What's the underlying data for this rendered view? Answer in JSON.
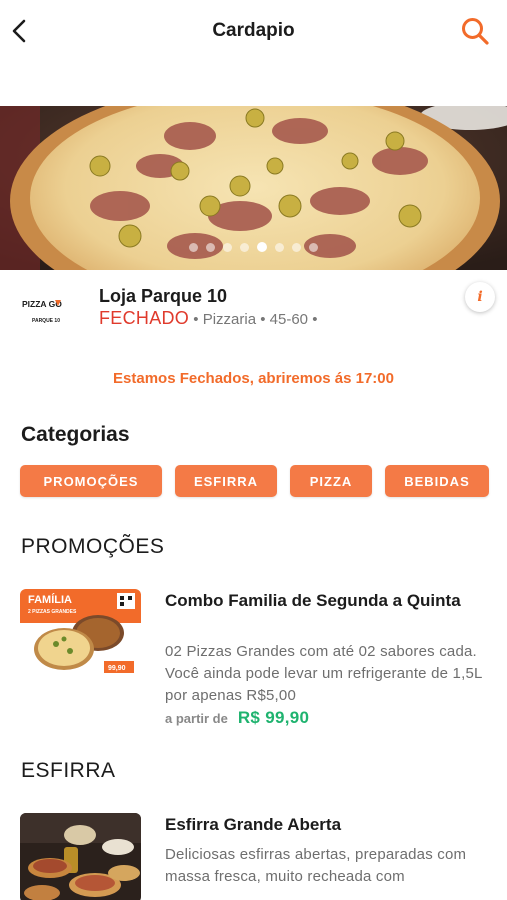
{
  "header": {
    "title": "Cardapio",
    "back_icon": "chevron-left-icon",
    "search_icon": "search-icon",
    "accent_color": "#f26b2a"
  },
  "banner": {
    "slide_count": 8,
    "active_slide": 4
  },
  "store": {
    "logo_text": "PIZZA GO",
    "logo_subtext": "PARQUE 10",
    "name": "Loja Parque 10",
    "status": "FECHADO",
    "category": "Pizzaria",
    "time": "45-60",
    "info_label": "i"
  },
  "closed_message": "Estamos Fechados, abriremos ás 17:00",
  "categories": {
    "title": "Categorias",
    "items": [
      "PROMOÇÕES",
      "ESFIRRA",
      "PIZZA",
      "BEBIDAS"
    ]
  },
  "sections": [
    {
      "title": "PROMOÇÕES",
      "product": {
        "name": "Combo Familia de Segunda a Quinta",
        "description": "02 Pizzas Grandes com até 02 sabores cada. Você ainda pode levar um refrigerante de 1,5L por apenas R$5,00",
        "price_prefix": "a partir de",
        "price": "R$ 99,90",
        "image_text_1": "FAMÍLIA",
        "image_text_2": "2 PIZZAS GRANDES",
        "image_text_3": "99,90"
      }
    },
    {
      "title": "ESFIRRA",
      "product": {
        "name": "Esfirra Grande Aberta",
        "description": "Deliciosas esfirras abertas, preparadas com massa fresca, muito recheada com"
      }
    }
  ],
  "colors": {
    "chip": "#f47a46",
    "status_closed": "#e03a2c",
    "price": "#1fb36f"
  }
}
